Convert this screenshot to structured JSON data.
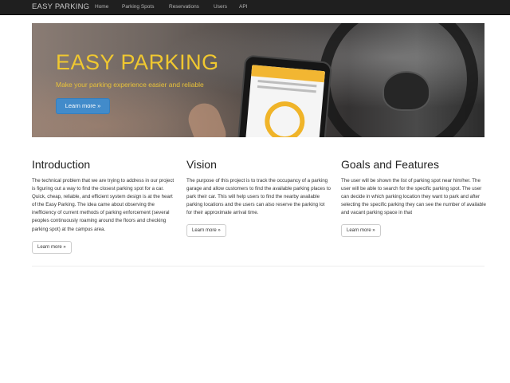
{
  "navbar": {
    "brand": "EASY PARKING",
    "links": [
      "Home",
      "Parking Spots",
      "Reservations",
      "Users",
      "API"
    ]
  },
  "hero": {
    "title": "EASY PARKING",
    "subtitle": "Make your parking experience easier and reliable",
    "button_label": "Learn more »"
  },
  "sections": [
    {
      "title": "Introduction",
      "text": "The technical problem that we are trying to address in our project is figuring out a way to find the closest parking spot for a car. Quick, cheap, reliable, and efficient system design is at the heart of the Easy Parking. The idea came about observing the inefficiency of current methods of parking enforcement (several peoples continuously roaming around the floors and checking parking spot) at the campus area.",
      "button_label": "Learn more »"
    },
    {
      "title": "Vision",
      "text": "The purpose of this project is to track the occupancy of a parking garage and allow customers to find the available parking places to park their car. This will help users to find the nearby available parking locations and the users can also reserve the parking lot for their approximate arrival time.",
      "button_label": "Learn more »"
    },
    {
      "title": "Goals and Features",
      "text": "The user will be shown the list of parking spot near him/her. The user will be able to search for the specific parking spot. The user can decide in which parking location they want to park and after selecting the specific parking they can see the number of available and vacant parking space in that",
      "button_label": "Learn more »"
    }
  ],
  "colors": {
    "navbar_bg": "#1f1f1f",
    "hero_title": "#f0c830",
    "primary_button": "#428bca"
  }
}
